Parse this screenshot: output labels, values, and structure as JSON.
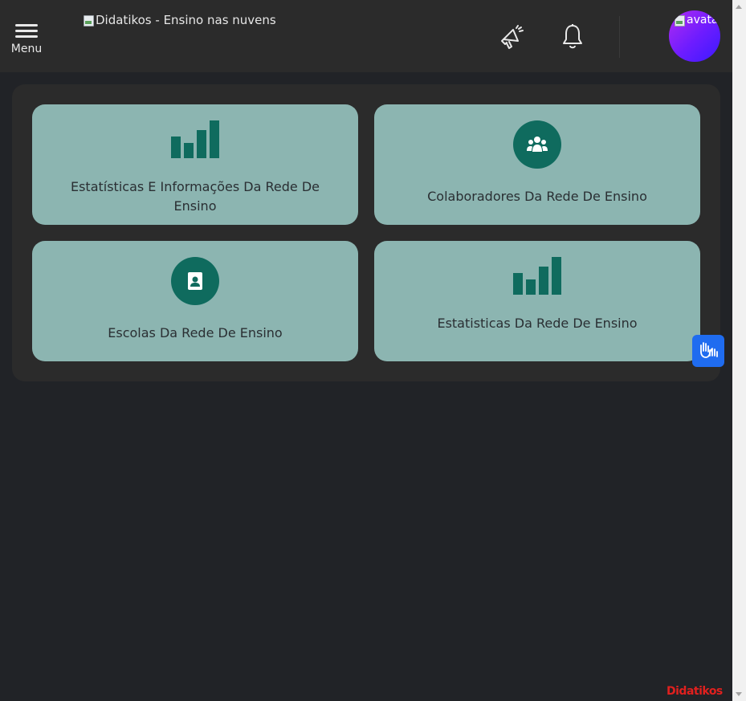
{
  "header": {
    "menu_label": "Menu",
    "logo_alt": "Didatikos - Ensino nas nuvens",
    "avatar_alt": "avatar"
  },
  "icons": {
    "menu": "hamburger-icon",
    "announcements": "megaphone-icon",
    "notifications": "bell-icon",
    "accessibility": "sign-language-hands-icon"
  },
  "cards": [
    {
      "title": "Estatísticas E Informações Da Rede De Ensino",
      "icon": "bar-chart-icon"
    },
    {
      "title": "Colaboradores Da Rede De Ensino",
      "icon": "users-group-icon"
    },
    {
      "title": "Escolas Da Rede De Ensino",
      "icon": "contact-badge-icon"
    },
    {
      "title": "Estatisticas Da Rede De Ensino",
      "icon": "bar-chart-icon"
    }
  ],
  "footer": {
    "brand": "Didatikos"
  },
  "colors": {
    "background": "#212327",
    "topbar": "#2b2b2b",
    "card": "#8cb5b1",
    "icon_accent": "#0f6b5e",
    "brand_red": "#e0201e",
    "vlibras_blue": "#1f6cf0"
  }
}
